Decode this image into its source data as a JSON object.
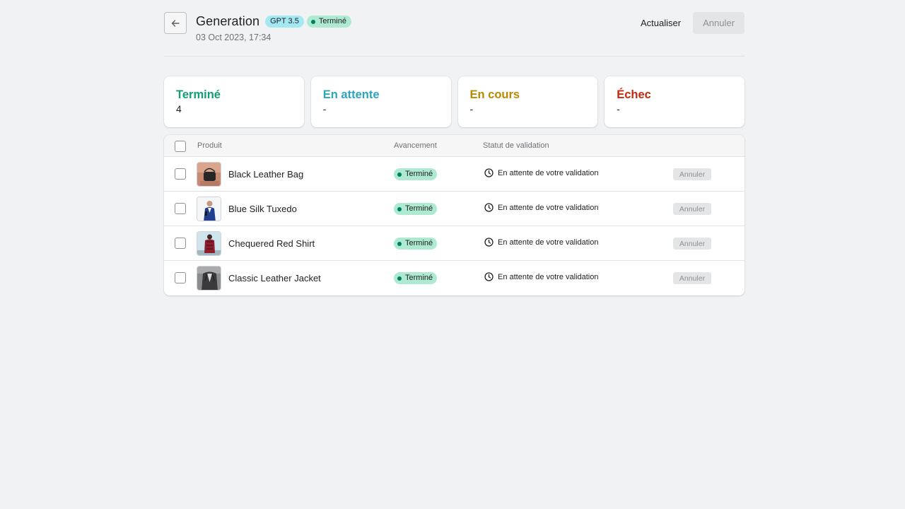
{
  "header": {
    "title": "Generation",
    "model_badge": "GPT 3.5",
    "status_badge": "Terminé",
    "date": "03 Oct 2023, 17:34",
    "refresh_label": "Actualiser",
    "cancel_label": "Annuler"
  },
  "stats": [
    {
      "label": "Terminé",
      "value": "4",
      "color": "#0f9f73"
    },
    {
      "label": "En attente",
      "value": "-",
      "color": "#2ba5c0"
    },
    {
      "label": "En cours",
      "value": "-",
      "color": "#b98900"
    },
    {
      "label": "Échec",
      "value": "-",
      "color": "#c5280c"
    }
  ],
  "table": {
    "columns": {
      "product": "Produit",
      "progress": "Avancement",
      "validation": "Statut de validation"
    },
    "rows": [
      {
        "name": "Black Leather Bag",
        "progress": "Terminé",
        "validation": "En attente de votre validation",
        "action": "Annuler",
        "thumb": "bag-thumbnail-icon"
      },
      {
        "name": "Blue Silk Tuxedo",
        "progress": "Terminé",
        "validation": "En attente de votre validation",
        "action": "Annuler",
        "thumb": "tuxedo-thumbnail-icon"
      },
      {
        "name": "Chequered Red Shirt",
        "progress": "Terminé",
        "validation": "En attente de votre validation",
        "action": "Annuler",
        "thumb": "shirt-thumbnail-icon"
      },
      {
        "name": "Classic Leather Jacket",
        "progress": "Terminé",
        "validation": "En attente de votre validation",
        "action": "Annuler",
        "thumb": "jacket-thumbnail-icon"
      }
    ]
  }
}
